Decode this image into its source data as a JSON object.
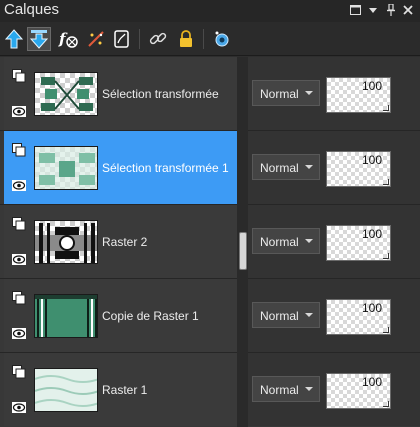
{
  "panel": {
    "title": "Calques",
    "window_controls": [
      "maximize-icon",
      "dropdown-icon",
      "pin-icon",
      "close-icon"
    ]
  },
  "toolbar": {
    "buttons": [
      "layer-up-icon",
      "layer-down-icon",
      "fx-icon",
      "adjust-icon",
      "mask-icon",
      "link-icon",
      "lock-icon",
      "view-icon"
    ],
    "active": "layer-down-icon"
  },
  "layers": [
    {
      "name": "Sélection transformée",
      "blend_mode": "Normal",
      "opacity": "100",
      "selected": false,
      "thumb": "teal-shapes-on-transparent"
    },
    {
      "name": "Sélection transformée 1",
      "blend_mode": "Normal",
      "opacity": "100",
      "selected": true,
      "thumb": "teal-pattern-faded"
    },
    {
      "name": "Raster 2",
      "blend_mode": "Normal",
      "opacity": "100",
      "selected": false,
      "thumb": "black-white-pattern"
    },
    {
      "name": "Copie de Raster 1",
      "blend_mode": "Normal",
      "opacity": "100",
      "selected": false,
      "thumb": "teal-stripes"
    },
    {
      "name": "Raster 1",
      "blend_mode": "Normal",
      "opacity": "100",
      "selected": false,
      "thumb": "pale-teal-texture"
    }
  ],
  "colors": {
    "selected_row": "#3d9bf5",
    "accent_teal": "#3f8f6f"
  }
}
